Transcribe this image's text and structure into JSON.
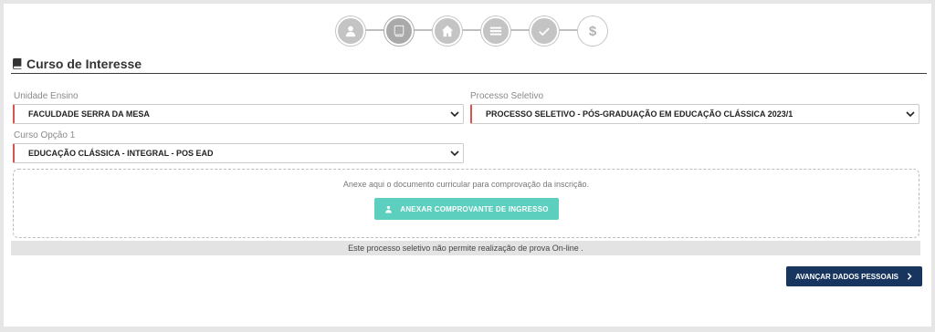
{
  "stepper": {
    "steps": [
      {
        "icon": "user-icon",
        "active": false
      },
      {
        "icon": "book-icon",
        "active": true
      },
      {
        "icon": "home-icon",
        "active": false
      },
      {
        "icon": "list-icon",
        "active": false
      },
      {
        "icon": "check-icon",
        "active": false
      },
      {
        "icon": "dollar-icon",
        "active": false,
        "glyph": "$"
      }
    ]
  },
  "section": {
    "title": "Curso de Interesse"
  },
  "form": {
    "unidade_label": "Unidade Ensino",
    "unidade_value": "FACULDADE SERRA DA MESA",
    "processo_label": "Processo Seletivo",
    "processo_value": "PROCESSO SELETIVO - PÓS-GRADUAÇÃO EM EDUCAÇÃO CLÁSSICA 2023/1",
    "curso_label": "Curso Opção 1",
    "curso_value": "EDUCAÇÃO CLÁSSICA - INTEGRAL - POS EAD"
  },
  "upload": {
    "instruction": "Anexe aqui o documento curricular para comprovação da inscrição.",
    "button_label": "ANEXAR COMPROVANTE DE INGRESSO"
  },
  "notice": {
    "text": "Este processo seletivo não permite realização de prova On-line ."
  },
  "actions": {
    "next_label": "AVANÇAR DADOS PESSOAIS"
  },
  "colors": {
    "accent_teal": "#5ccfbf",
    "primary_navy": "#17355f",
    "required_red": "#d9534f"
  }
}
